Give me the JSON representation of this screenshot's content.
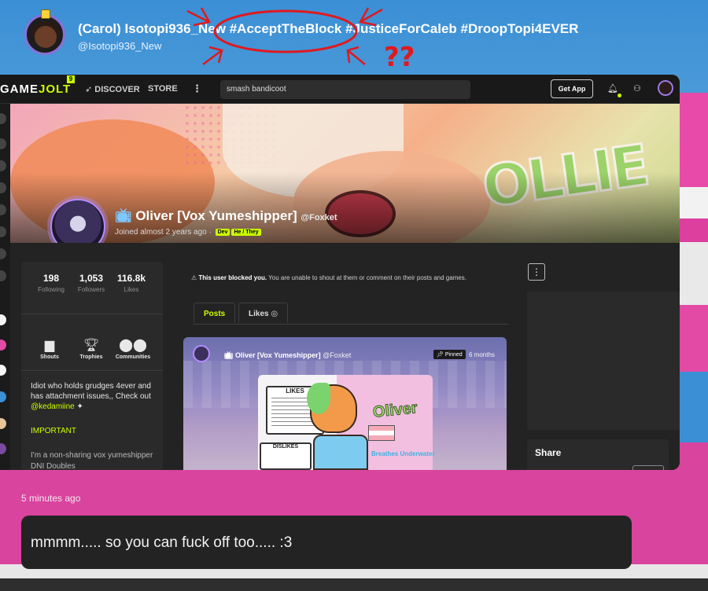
{
  "header": {
    "display_name": "(Carol) Isotopi936_New #AcceptTheBlock #JusticeForCaleb #DroopTopi4EVER",
    "handle": "@Isotopi936_New",
    "annotation": "??"
  },
  "gamejolt": {
    "logo_game": "GAME",
    "logo_jolt": "JOLT",
    "logo_badge": "9",
    "nav_discover": "DISCOVER",
    "nav_store": "STORE",
    "search_value": "smash bandicoot",
    "get_app": "Get App"
  },
  "profile": {
    "name": "Oliver [Vox Yumeshipper]",
    "handle": "@Foxket",
    "joined": "Joined almost 2 years ago",
    "tags": [
      "Dev",
      "He / They"
    ],
    "banner_text": "OLLIE",
    "stats": [
      {
        "value": "198",
        "label": "Following"
      },
      {
        "value": "1,053",
        "label": "Followers"
      },
      {
        "value": "116.8k",
        "label": "Likes"
      }
    ],
    "actions": [
      "Shouts",
      "Trophies",
      "Communities"
    ],
    "bio_line": "Idiot who holds grudges 4ever and has attachment issues,, Check out",
    "bio_mention": "@kedamiine",
    "bio_important": "IMPORTANT",
    "bio_more": "I'm a  non-sharing vox yumeshipper DNI Doubles"
  },
  "blocked_notice": {
    "bold": "This user blocked you.",
    "rest": "You are unable to shout at them or comment on their posts and games."
  },
  "tabs": [
    {
      "label": "Posts",
      "active": true
    },
    {
      "label": "Likes",
      "active": false
    }
  ],
  "post": {
    "author": "Oliver [Vox Yumeshipper]",
    "handle": "@Foxket",
    "pinned": "Pinned",
    "time": "6 months",
    "likes_title": "LIKES",
    "dislikes_title": "DISLIKES",
    "art_title": "Oliver",
    "art_subtitle": "Breathes Underwater"
  },
  "share": {
    "title": "Share"
  },
  "message": {
    "time": "5 minutes ago",
    "text": "mmmm..... so you can fuck off too..... :3"
  },
  "colors": {
    "accent": "#ccff00",
    "pink": "#e24aa6",
    "blue": "#3b8fd5"
  }
}
